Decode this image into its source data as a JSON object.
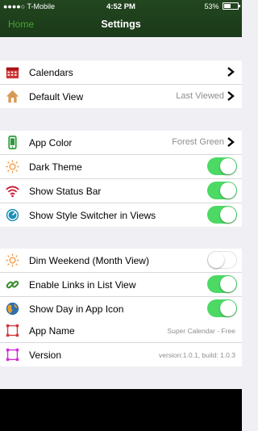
{
  "status_bar": {
    "carrier": "●●●●○ T-Mobile",
    "time": "4:52 PM",
    "battery": "53%",
    "battery_level": 0.53
  },
  "nav": {
    "home_label": "Home",
    "title": "Settings"
  },
  "groups": [
    [
      {
        "label": "Calendars",
        "value": "",
        "control": "chevron",
        "icon": "calendar-icon"
      },
      {
        "label": "Default View",
        "value": "Last Viewed",
        "control": "chevron",
        "icon": "home-icon"
      }
    ],
    [
      {
        "label": "App Color",
        "value": "Forest Green",
        "control": "chevron",
        "icon": "phone-icon"
      },
      {
        "label": "Dark Theme",
        "control": "toggle",
        "on": true,
        "icon": "sun-icon"
      },
      {
        "label": "Show Status Bar",
        "control": "toggle",
        "on": true,
        "icon": "wifi-icon"
      },
      {
        "label": "Show Style Switcher in Views",
        "control": "toggle",
        "on": true,
        "icon": "speedometer-icon"
      }
    ],
    [
      {
        "label": "Dim Weekend (Month View)",
        "control": "toggle",
        "on": false,
        "icon": "sun-icon"
      },
      {
        "label": "Enable Links in List View",
        "control": "toggle",
        "on": true,
        "icon": "link-icon"
      },
      {
        "label": "Show Day in App Icon",
        "control": "toggle",
        "on": true,
        "icon": "globe-icon"
      }
    ],
    [
      {
        "label": "App Name",
        "value": "Super Calendar - Free",
        "control": "none",
        "icon": "frame-red-icon"
      },
      {
        "label": "Version",
        "value": "version:1.0.1, build: 1.0.3",
        "control": "none",
        "icon": "frame-magenta-icon"
      }
    ]
  ],
  "colors": {
    "header": "#1b3a19",
    "accent": "#45a336",
    "toggle_on": "#4cd964",
    "background": "#efeff4"
  }
}
